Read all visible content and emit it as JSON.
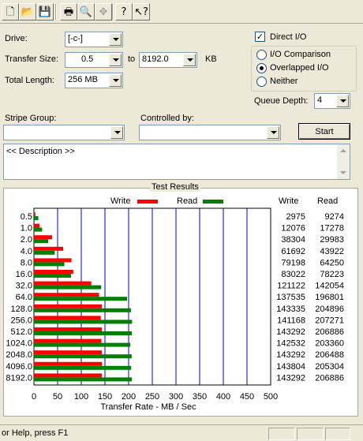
{
  "toolbar": {
    "buttons": [
      {
        "name": "new-icon",
        "glyph": "🗋"
      },
      {
        "name": "open-folder-icon",
        "glyph": "📂"
      },
      {
        "name": "save-icon",
        "glyph": "💾"
      },
      {
        "name": "print-icon",
        "glyph": "🖶"
      },
      {
        "name": "print-preview-icon",
        "glyph": "🔍"
      },
      {
        "name": "move-icon",
        "glyph": "✥"
      },
      {
        "name": "help-icon",
        "glyph": "?"
      },
      {
        "name": "context-help-icon",
        "glyph": "↖?"
      }
    ]
  },
  "drive": {
    "label": "Drive:",
    "value": "[-c-]"
  },
  "transfer_size": {
    "label": "Transfer Size:",
    "from": "0.5",
    "to_label": "to",
    "to": "8192.0",
    "unit": "KB"
  },
  "total_length": {
    "label": "Total Length:",
    "value": "256 MB"
  },
  "direct_io": {
    "label": "Direct I/O",
    "checked": true
  },
  "modes": [
    {
      "label": "I/O Comparison",
      "selected": false
    },
    {
      "label": "Overlapped I/O",
      "selected": true
    },
    {
      "label": "Neither",
      "selected": false
    }
  ],
  "queue_depth": {
    "label": "Queue Depth:",
    "value": "4"
  },
  "stripe_group": {
    "label": "Stripe Group:",
    "value": ""
  },
  "controlled_by": {
    "label": "Controlled by:",
    "value": ""
  },
  "start_button": "Start",
  "description": "<< Description >>",
  "results": {
    "title": "Test Results",
    "legend_write": "Write",
    "legend_read": "Read",
    "col_write": "Write",
    "col_read": "Read"
  },
  "chart_data": {
    "type": "bar",
    "orientation": "horizontal",
    "categories": [
      "0.5",
      "1.0",
      "2.0",
      "4.0",
      "8.0",
      "16.0",
      "32.0",
      "64.0",
      "128.0",
      "256.0",
      "512.0",
      "1024.0",
      "2048.0",
      "4096.0",
      "8192.0"
    ],
    "series": [
      {
        "name": "Write",
        "color": "#ff0000",
        "values": [
          2975,
          12076,
          38304,
          61692,
          79198,
          83022,
          121122,
          137535,
          143335,
          141168,
          143292,
          142532,
          143292,
          143804,
          143292
        ]
      },
      {
        "name": "Read",
        "color": "#008000",
        "values": [
          9274,
          17278,
          29983,
          43922,
          64250,
          78223,
          142054,
          196801,
          204896,
          207271,
          206886,
          203360,
          206488,
          205304,
          206886
        ]
      }
    ],
    "xlabel": "Transfer Rate - MB / Sec",
    "xlim": [
      0,
      500
    ],
    "xticks": [
      0,
      50,
      100,
      150,
      200,
      250,
      300,
      350,
      400,
      450,
      500
    ],
    "grid": true,
    "legend": "top"
  },
  "status": {
    "text": "or Help, press F1"
  }
}
